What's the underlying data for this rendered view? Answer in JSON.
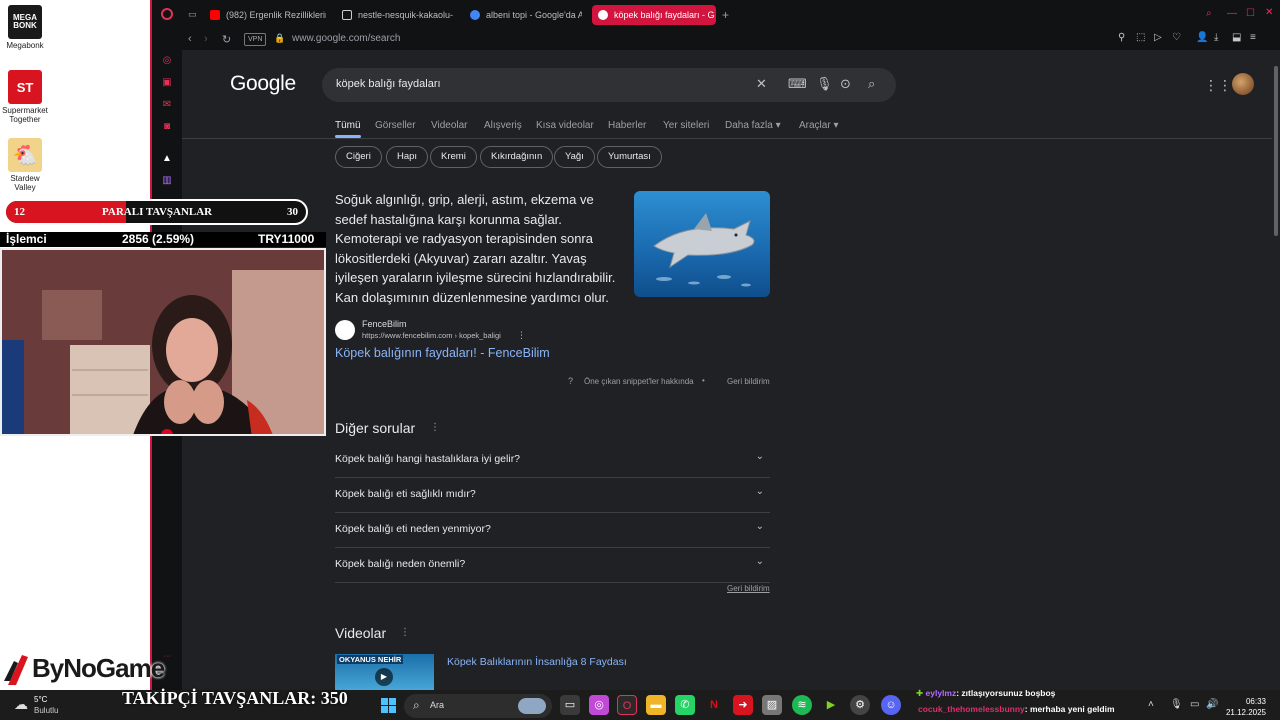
{
  "desktop": {
    "icons": [
      {
        "label": "Megabonk",
        "color": "#1a1a1a",
        "glyph": "MEGA BONK"
      },
      {
        "label": "Supermarket Together",
        "color": "#d7141f",
        "glyph": "ST"
      },
      {
        "label": "Stardew Valley",
        "color": "#e9c26b",
        "glyph": "🐔"
      }
    ]
  },
  "browser": {
    "tabs": [
      {
        "label": "(982) Ergenlik Rezilliklerin",
        "favicon_color": "#ff0000",
        "active": false
      },
      {
        "label": "nestle-nesquik-kakaolu-",
        "favicon_color": "#dddddd",
        "active": false
      },
      {
        "label": "albeni topi - Google'da A",
        "favicon_color": "#4285f4",
        "active": false
      },
      {
        "label": "köpek balığı faydaları - G",
        "favicon_color": "#ffffff",
        "active": true
      }
    ],
    "new_tab": "+",
    "vpn": "VPN",
    "url": "www.google.com/search"
  },
  "google": {
    "logo": "Google",
    "query": "köpek balığı faydaları",
    "nav_tabs": [
      "Tümü",
      "Görseller",
      "Videolar",
      "Alışveriş",
      "Kısa videolar",
      "Haberler",
      "Yer siteleri",
      "Daha fazla ▾",
      "Araçlar ▾"
    ],
    "chips": [
      "Ciğeri",
      "Hapı",
      "Kremi",
      "Kıkırdağının",
      "Yağı",
      "Yumurtası"
    ],
    "snippet": {
      "text": "Soğuk algınlığı, grip, alerji, astım, ekzema ve sedef hastalığına karşı korunma sağlar. Kemoterapi ve radyasyon terapisinden sonra lökositlerdeki (Akyuvar) zararı azaltır. Yavaş iyileşen yaraların iyileşme sürecini hızlandırabilir. Kan dolaşımının düzenlenmesine yardımcı olur.",
      "source_name": "FenceBilim",
      "source_url": "https://www.fencebilim.com › kopek_baligi",
      "link": "Köpek balığının faydaları! - FenceBilim",
      "about": "Öne çıkan snippet'ler hakkında",
      "feedback": "Geri bildirim"
    },
    "paa": {
      "title": "Diğer sorular",
      "questions": [
        "Köpek balığı hangi hastalıklara iyi gelir?",
        "Köpek balığı eti sağlıklı mıdır?",
        "Köpek balığı eti neden yenmiyor?",
        "Köpek balığı neden önemli?"
      ],
      "feedback": "Geri bildirim"
    },
    "videos": {
      "title": "Videolar",
      "first_title": "Köpek Balıklarının İnsanlığa 8 Faydası",
      "thumb_text": "OKYANUS NEHİR"
    }
  },
  "overlay": {
    "goal_bar": {
      "left": "12",
      "title": "PARALI TAVŞANLAR",
      "right": "30",
      "progress": 0.4
    },
    "ticker": {
      "name": "İşlemci",
      "value": "2856 (2.59%)",
      "currency": "TRY11000"
    },
    "sponsor": "ByNoGame",
    "followers": "TAKİPÇİ TAVŞANLAR: 350"
  },
  "taskbar": {
    "weather_temp": "5°C",
    "weather_desc": "Bulutlu",
    "search_label": "Ara",
    "chat": [
      {
        "user": "eylylmz",
        "user_color": "#b76bff",
        "message": "zıtlaşıyorsunuz boşboş"
      },
      {
        "user": "cocuk_thehomelessbunny",
        "user_color": "#d92f6f",
        "message": "merhaba yeni geldim"
      }
    ],
    "time": "06:33",
    "date": "21.12.2025"
  }
}
